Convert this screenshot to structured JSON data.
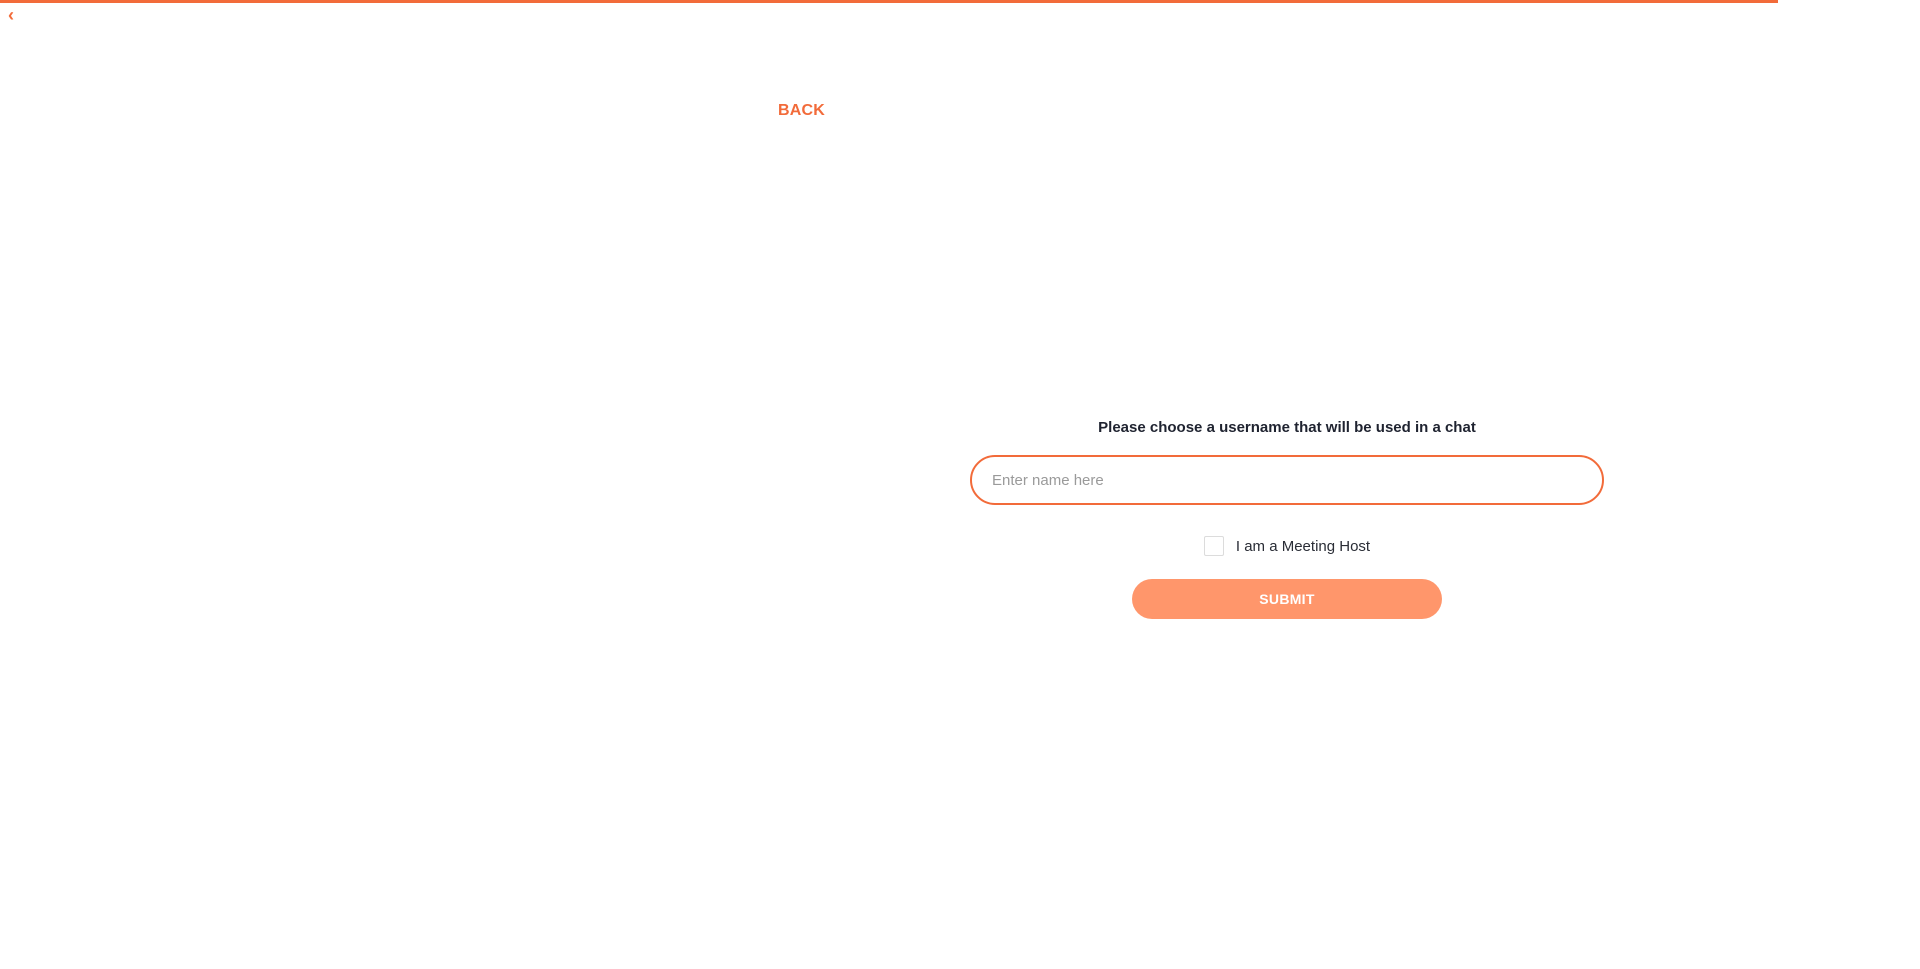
{
  "header": {
    "back_label": "BACK",
    "corner_glyph": "‹"
  },
  "form": {
    "prompt": "Please choose a username that will be used in a chat",
    "name_placeholder": "Enter name here",
    "name_value": "",
    "host_checkbox_label": "I am a Meeting Host",
    "host_checked": false,
    "submit_label": "SUBMIT"
  },
  "theme": {
    "accent": "#f26b3a",
    "button": "#ff966b",
    "text": "#1f2330"
  }
}
